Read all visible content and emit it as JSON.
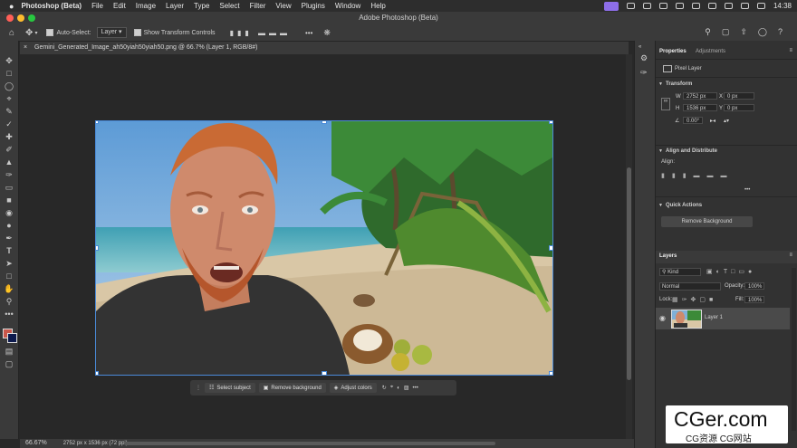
{
  "menubar": {
    "app_name": "Photoshop (Beta)",
    "items": [
      "File",
      "Edit",
      "Image",
      "Layer",
      "Type",
      "Select",
      "Filter",
      "View",
      "Plugins",
      "Window",
      "Help"
    ],
    "clock": "14:38"
  },
  "window": {
    "title": "Adobe Photoshop (Beta)"
  },
  "options": {
    "auto_select_label": "Auto-Select:",
    "auto_select_value": "Layer",
    "transform_label": "Show Transform Controls"
  },
  "document": {
    "tab_label": "Gemini_Generated_Image_ah50yiah50yiah50.png @ 66.7% (Layer 1, RGB/8#)"
  },
  "taskbar": {
    "select_subject": "Select subject",
    "remove_background": "Remove background",
    "adjust_colors": "Adjust colors",
    "more": "•••"
  },
  "status": {
    "zoom": "66.67%",
    "info": "2752 px x 1536 px (72 ppi)"
  },
  "properties": {
    "tab_properties": "Properties",
    "tab_adjustments": "Adjustments",
    "layer_kind": "Pixel Layer",
    "transform_title": "Transform",
    "w_label": "W",
    "w_value": "2752 px",
    "h_label": "H",
    "h_value": "1536 px",
    "x_label": "X",
    "x_value": "0 px",
    "y_label": "Y",
    "y_value": "0 px",
    "angle_value": "0.00°",
    "align_title": "Align and Distribute",
    "align_label": "Align:",
    "quick_actions_title": "Quick Actions",
    "remove_bg_button": "Remove Background"
  },
  "layers": {
    "title": "Layers",
    "kind_filter": "Kind",
    "blend_mode": "Normal",
    "opacity_label": "Opacity:",
    "opacity_value": "100%",
    "lock_label": "Lock:",
    "fill_label": "Fill:",
    "fill_value": "100%",
    "layer_name": "Layer 1"
  },
  "watermark": {
    "big": "CGer.com",
    "small": "CG资源  CG网站"
  },
  "colors": {
    "accent": "#4a8ad8",
    "foreground": "#c9574b",
    "background": "#0d1a4d",
    "menu_highlight": "#8d6ee8"
  }
}
